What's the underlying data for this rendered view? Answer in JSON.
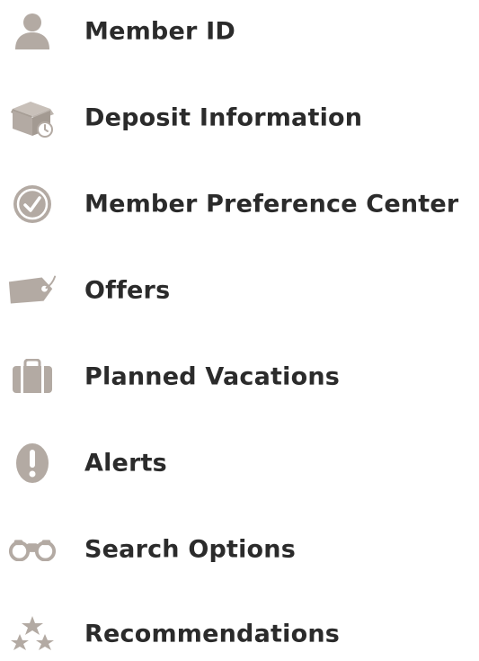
{
  "colors": {
    "icon": "#b3aaa3",
    "label": "#2b2b2b",
    "background": "#ffffff"
  },
  "menu": {
    "items": [
      {
        "label": "Member ID",
        "icon": "person-icon"
      },
      {
        "label": "Deposit Information",
        "icon": "deposit-box-icon"
      },
      {
        "label": "Member Preference Center",
        "icon": "check-circle-icon"
      },
      {
        "label": "Offers",
        "icon": "tag-icon"
      },
      {
        "label": "Planned Vacations",
        "icon": "suitcase-icon"
      },
      {
        "label": "Alerts",
        "icon": "exclamation-icon"
      },
      {
        "label": "Search Options",
        "icon": "binoculars-icon"
      },
      {
        "label": "Recommendations",
        "icon": "stars-icon"
      }
    ]
  }
}
